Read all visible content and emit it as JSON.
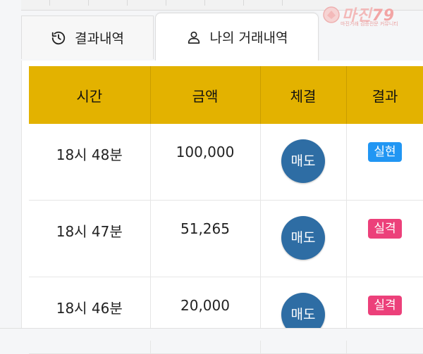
{
  "tabs": [
    {
      "label": "결과내역",
      "icon": "history-icon",
      "active": false
    },
    {
      "label": "나의 거래내역",
      "icon": "user-icon",
      "active": true
    }
  ],
  "logo": {
    "title": "마진",
    "number": "79",
    "subtitle": "마진거래 검증전문 커뮤니티"
  },
  "colors": {
    "header_bg": "#e3b200",
    "trade_btn": "#2e6da4",
    "success": "#2196f3",
    "fail": "#ec407a"
  },
  "table": {
    "headers": [
      "시간",
      "금액",
      "체결",
      "결과"
    ],
    "rows": [
      {
        "time": "18시 48분",
        "amount": "100,000",
        "trade": "매도",
        "result": "실현",
        "result_color": "#2196f3"
      },
      {
        "time": "18시 47분",
        "amount": "51,265",
        "trade": "매도",
        "result": "실격",
        "result_color": "#ec407a"
      },
      {
        "time": "18시 46분",
        "amount": "20,000",
        "trade": "매도",
        "result": "실격",
        "result_color": "#ec407a"
      }
    ]
  }
}
